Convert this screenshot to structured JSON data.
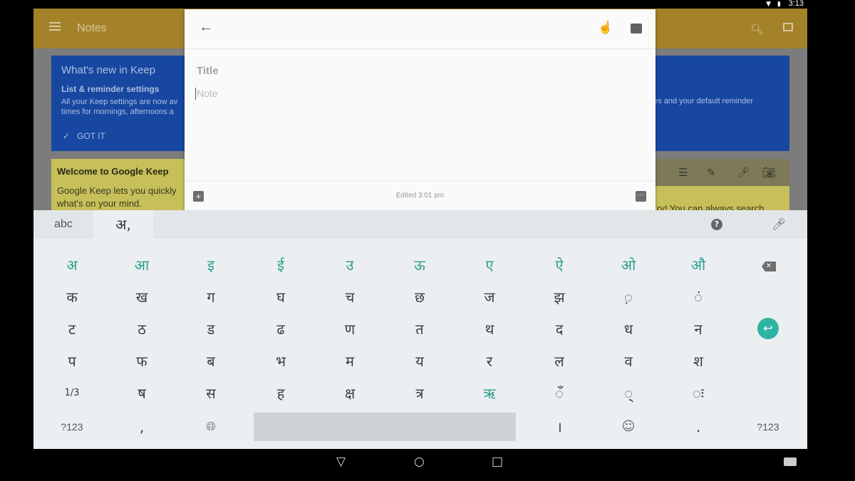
{
  "status": {
    "time": "3:13"
  },
  "app": {
    "title": "Notes"
  },
  "whats_new": {
    "heading": "What's new in Keep",
    "subheading": "List & reminder settings",
    "body": "All your Keep settings are now av times for mornings, afternoons a",
    "body_right": "tes and your default reminder",
    "action": "GOT IT"
  },
  "welcome": {
    "heading": "Welcome to Google Keep",
    "body": "Google Keep lets you quickly what's on your mind.",
    "body_right": "ry! You can always search"
  },
  "editor": {
    "title_placeholder": "Title",
    "note_placeholder": "Note",
    "edited": "Edited 3:01 pm"
  },
  "keyboard": {
    "tab_abc": "abc",
    "tab_hindi": "अ,",
    "rows": [
      [
        "अ",
        "आ",
        "इ",
        "ई",
        "उ",
        "ऊ",
        "ए",
        "ऐ",
        "ओ",
        "औ"
      ],
      [
        "क",
        "ख",
        "ग",
        "घ",
        "च",
        "छ",
        "ज",
        "झ",
        "◌़",
        "◌ं"
      ],
      [
        "ट",
        "ठ",
        "ड",
        "ढ",
        "ण",
        "त",
        "थ",
        "द",
        "ध",
        "न"
      ],
      [
        "प",
        "फ",
        "ब",
        "भ",
        "म",
        "य",
        "र",
        "ल",
        "व",
        "श"
      ],
      [
        "1/3",
        "ष",
        "स",
        "ह",
        "क्ष",
        "त्र",
        "ऋ",
        "◌ँ",
        "◌्",
        "◌ः"
      ]
    ],
    "bottom": {
      "sym_left": "?123",
      "comma": ",",
      "danda": "।",
      "period": ".",
      "sym_right": "?123"
    }
  },
  "icons": {
    "back": "back-arrow-icon",
    "hand": "hand-pointer-icon",
    "archive": "archive-icon",
    "search": "search-icon",
    "grid": "grid-view-icon",
    "mic": "mic-icon",
    "help": "help-icon",
    "globe": "globe-icon",
    "emoji": "emoji-icon",
    "enter": "enter-icon",
    "backspace": "backspace-icon"
  },
  "colors": {
    "appbar": "#a3822a",
    "blue_card": "#1747a0",
    "yellow_card": "#c6bf5a",
    "teal": "#2a9d8f"
  }
}
